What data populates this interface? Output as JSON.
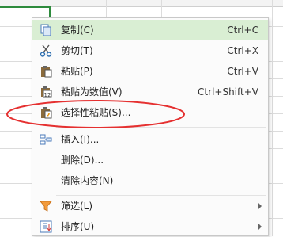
{
  "menu": {
    "items": [
      {
        "label": "复制(C)",
        "shortcut": "Ctrl+C",
        "icon": "copy-icon"
      },
      {
        "label": "剪切(T)",
        "shortcut": "Ctrl+X",
        "icon": "cut-icon"
      },
      {
        "label": "粘贴(P)",
        "shortcut": "Ctrl+V",
        "icon": "paste-icon"
      },
      {
        "label": "粘贴为数值(V)",
        "shortcut": "Ctrl+Shift+V",
        "icon": "paste-values-icon"
      },
      {
        "label": "选择性粘贴(S)...",
        "shortcut": "",
        "icon": "paste-special-icon"
      },
      {
        "label": "插入(I)...",
        "shortcut": "",
        "icon": "insert-icon"
      },
      {
        "label": "删除(D)...",
        "shortcut": "",
        "icon": ""
      },
      {
        "label": "清除内容(N)",
        "shortcut": "",
        "icon": ""
      },
      {
        "label": "筛选(L)",
        "shortcut": "",
        "icon": "filter-icon"
      },
      {
        "label": "排序(U)",
        "shortcut": "",
        "icon": "sort-icon"
      }
    ]
  },
  "colors": {
    "highlight": "#d9eed3",
    "selection_border": "#2e8b3d",
    "annotation": "#e53030"
  }
}
